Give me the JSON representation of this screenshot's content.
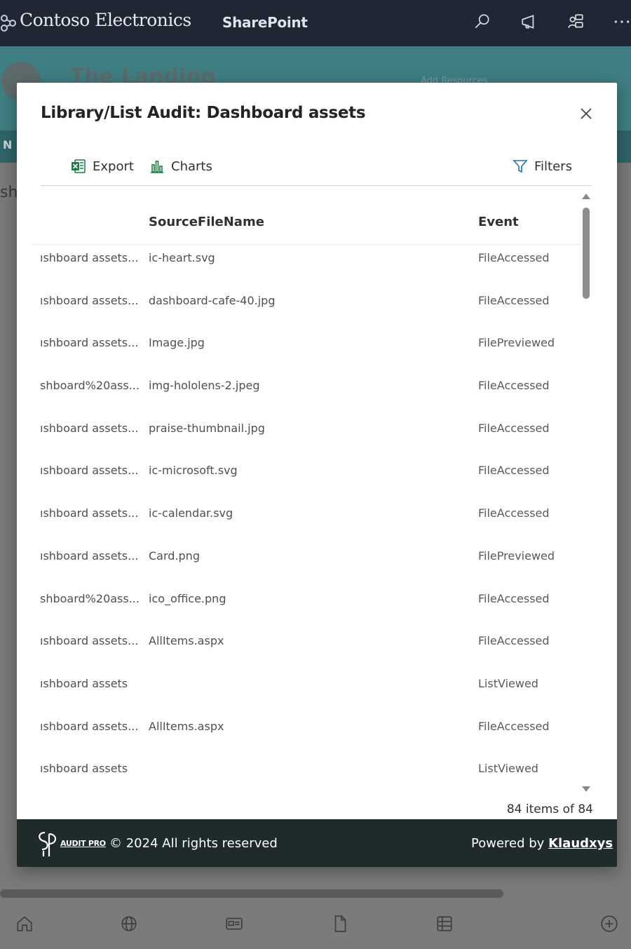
{
  "suite_bar": {
    "brand": "Contoso Electronics",
    "app": "SharePoint"
  },
  "background_page": {
    "site_title": "The Landing",
    "site_nav_hint": "Add Resources",
    "hub_hint": "N",
    "side_hint": "sh"
  },
  "modal": {
    "title": "Library/List Audit: Dashboard assets",
    "toolbar": {
      "export_label": "Export",
      "charts_label": "Charts",
      "filters_label": "Filters"
    },
    "columns": [
      "",
      "SourceFileName",
      "Event"
    ],
    "rows": [
      {
        "path": "ıshboard assets...",
        "file": "ic-heart.svg",
        "event": "FileAccessed"
      },
      {
        "path": "ıshboard assets...",
        "file": "dashboard-cafe-40.jpg",
        "event": "FileAccessed"
      },
      {
        "path": "ıshboard assets...",
        "file": "Image.jpg",
        "event": "FilePreviewed"
      },
      {
        "path": "shboard%20ass...",
        "file": "img-hololens-2.jpeg",
        "event": "FileAccessed"
      },
      {
        "path": "ıshboard assets...",
        "file": "praise-thumbnail.jpg",
        "event": "FileAccessed"
      },
      {
        "path": "ıshboard assets...",
        "file": "ic-microsoft.svg",
        "event": "FileAccessed"
      },
      {
        "path": "ıshboard assets...",
        "file": "ic-calendar.svg",
        "event": "FileAccessed"
      },
      {
        "path": "ıshboard assets...",
        "file": "Card.png",
        "event": "FilePreviewed"
      },
      {
        "path": "shboard%20ass...",
        "file": "ico_office.png",
        "event": "FileAccessed"
      },
      {
        "path": "ıshboard assets...",
        "file": "AllItems.aspx",
        "event": "FileAccessed"
      },
      {
        "path": "ıshboard assets",
        "file": "",
        "event": "ListViewed"
      },
      {
        "path": "ıshboard assets...",
        "file": "AllItems.aspx",
        "event": "FileAccessed"
      },
      {
        "path": "ıshboard assets",
        "file": "",
        "event": "ListViewed"
      }
    ],
    "item_count": "84 items of 84",
    "footer": {
      "logo_text": "AUDIT PRO",
      "copyright": "© 2024 All rights reserved",
      "powered_prefix": "Powered by ",
      "powered_link": "Klaudxys"
    }
  },
  "colors": {
    "suite_bar": "#1f2735",
    "footer": "#1f2a2a",
    "export_icon": "#1d7a45",
    "charts_icon": "#1d7a45"
  },
  "icons": {
    "suite": [
      "search-icon",
      "megaphone-icon",
      "share-icon",
      "more-icon"
    ],
    "bottom_nav": [
      "home-icon",
      "globe-icon",
      "news-icon",
      "file-icon",
      "list-icon",
      "add-icon"
    ]
  }
}
